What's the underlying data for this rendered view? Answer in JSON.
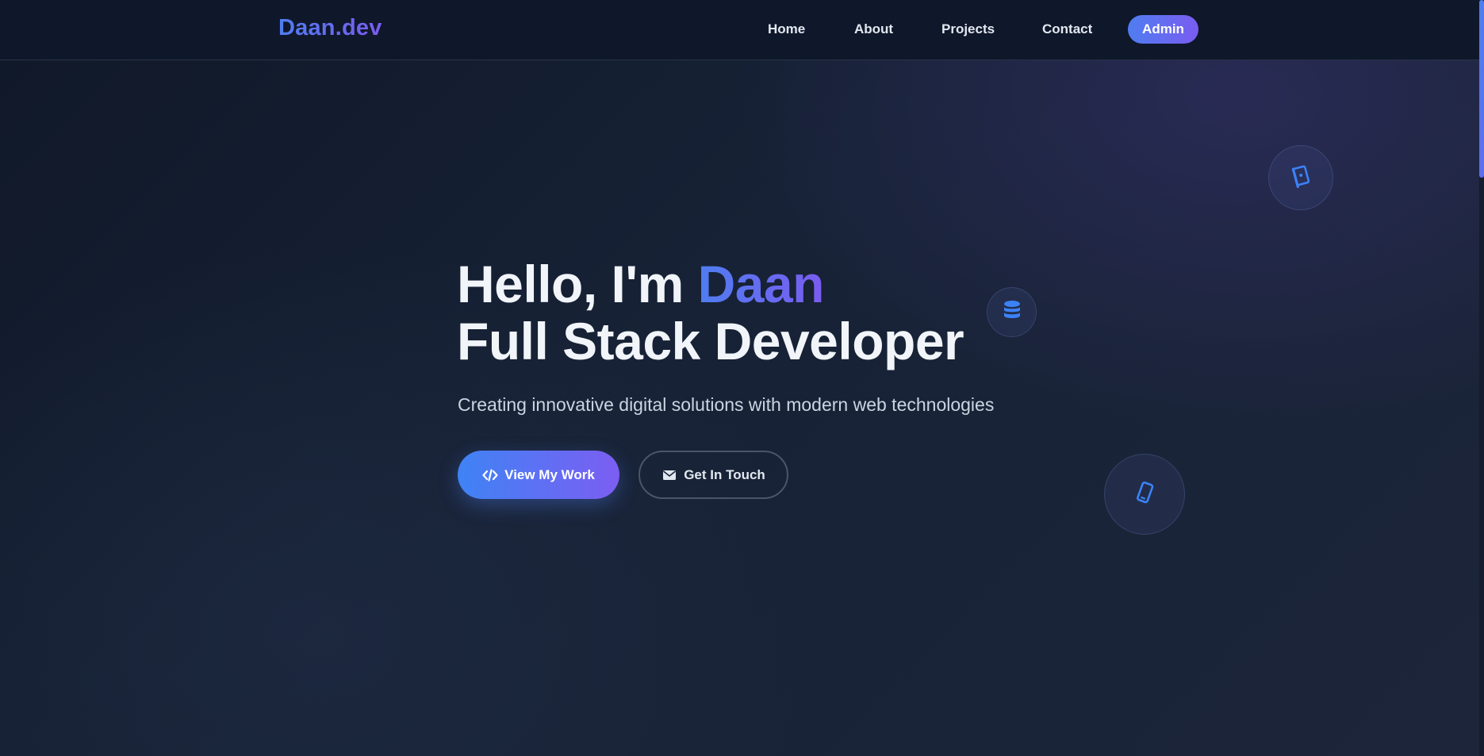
{
  "navbar": {
    "logo": "Daan.dev",
    "links": {
      "home": "Home",
      "about": "About",
      "projects": "Projects",
      "contact": "Contact"
    },
    "admin_label": "Admin"
  },
  "hero": {
    "greeting_prefix": "Hello, I'm ",
    "name": "Daan",
    "role": "Full Stack Developer",
    "subtitle": "Creating innovative digital solutions with modern web technologies",
    "primary_button": "View My Work",
    "secondary_button": "Get In Touch",
    "primary_icon": "code-icon",
    "secondary_icon": "envelope-icon"
  },
  "floating_icons": [
    "book-icon",
    "database-icon",
    "mobile-icon"
  ],
  "colors": {
    "accent_blue": "#4f7df0",
    "accent_purple": "#7a5cf0",
    "background": "#141c2e",
    "navbar_bg": "#0f172a",
    "text_primary": "#f1f5f9",
    "text_secondary": "#cbd5e1",
    "icon_blue": "#3b82f6"
  }
}
